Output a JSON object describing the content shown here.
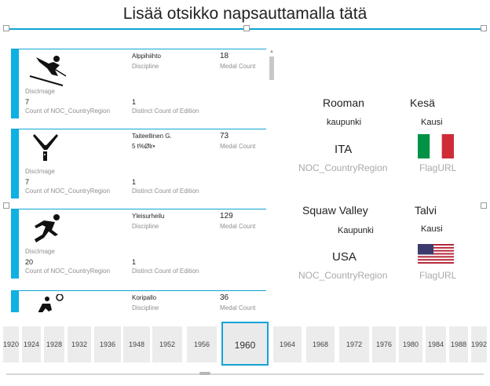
{
  "title": "Lisää otsikko napsauttamalla tätä",
  "cards": [
    {
      "discipline": "Alppihiihto",
      "discipline_label": "Discipline",
      "medal_count": "18",
      "medal_label": "Medal Count",
      "disc_image_label": "DiscImage",
      "count_noc": "7",
      "count_noc_label": "Count of NOC_CountryRegion",
      "distinct_edition": "1",
      "distinct_edition_label": "Distinct Count of Edition",
      "icon": "alpine-skiing-icon"
    },
    {
      "discipline": "Taiteellinen G.",
      "discipline_label": "5 t%Ølr•",
      "medal_count": "73",
      "medal_label": "Medal Count",
      "disc_image_label": "DiscImage",
      "count_noc": "7",
      "count_noc_label": "Count of NOC_CountryRegion",
      "distinct_edition": "1",
      "distinct_edition_label": "Distinct Count of Edition",
      "icon": "gymnastics-icon"
    },
    {
      "discipline": "Yleisurheilu",
      "discipline_label": "Discipline",
      "medal_count": "129",
      "medal_label": "Medal Count",
      "disc_image_label": "DiscImage",
      "count_noc": "20",
      "count_noc_label": "Count of NOC_CountryRegion",
      "distinct_edition": "1",
      "distinct_edition_label": "Distinct Count of Edition",
      "icon": "athletics-icon"
    },
    {
      "discipline": "Koripallo",
      "discipline_label": "Discipline",
      "medal_count": "36",
      "medal_label": "Medal Count",
      "icon": "basketball-icon"
    }
  ],
  "detail1": {
    "city": "Rooman",
    "city_label": "kaupunki",
    "season": "Kesä",
    "season_label": "Kausi",
    "noc": "ITA",
    "noc_label": "NOC_CountryRegion",
    "flag_label": "FlagURL"
  },
  "detail2": {
    "city": "Squaw Valley",
    "city_label": "Kaupunki",
    "season": "Talvi",
    "season_label": "Kausi",
    "noc": "USA",
    "noc_label": "NOC_CountryRegion",
    "flag_label": "FlagURL"
  },
  "timeline": {
    "selected": "1960",
    "years": [
      "1920",
      "1924",
      "1928",
      "1932",
      "1936",
      "1948",
      "1952",
      "1956",
      "1960",
      "1964",
      "1968",
      "1972",
      "1976",
      "1980",
      "1984",
      "1988",
      "1992"
    ]
  },
  "colors": {
    "accent": "#0fb0e4",
    "italy_green": "#009246",
    "italy_red": "#ce2b37",
    "usa_red": "#b22234",
    "usa_blue": "#3c3b6e"
  }
}
